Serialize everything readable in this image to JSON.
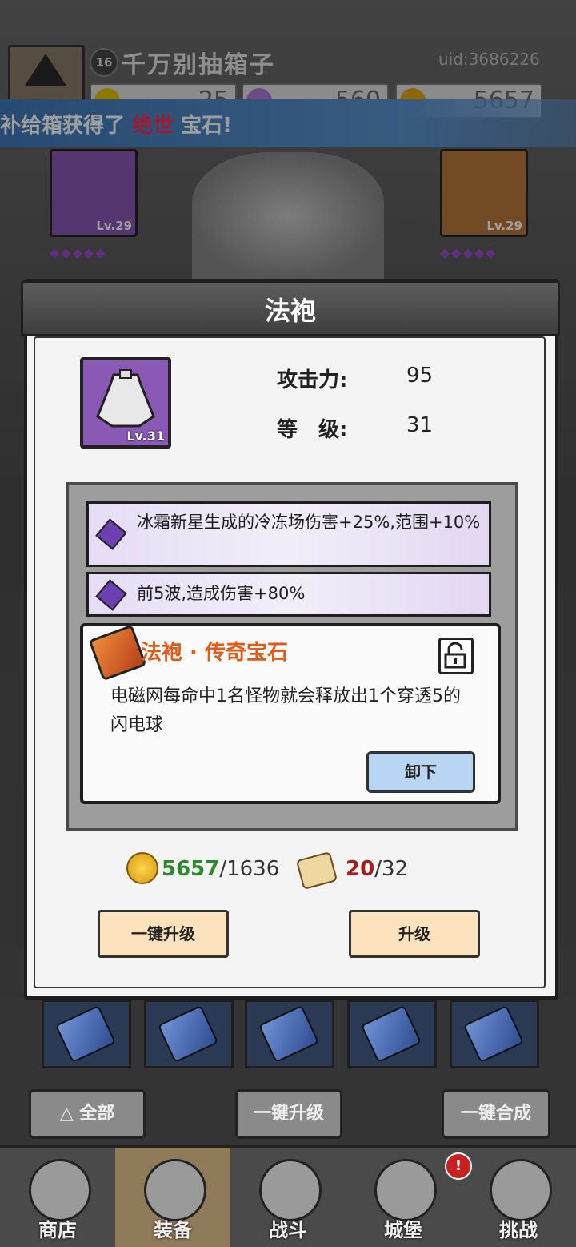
{
  "header": {
    "level": "16",
    "player_name": "千万别抽箱子",
    "uid": "uid:3686226",
    "resources": [
      {
        "name": "energy",
        "value": "25",
        "color": "#e6c400"
      },
      {
        "name": "gem",
        "value": "560",
        "color": "#b07ad8"
      },
      {
        "name": "gold",
        "value": "5657",
        "color": "#e0a818"
      }
    ]
  },
  "banner": {
    "prefix": "补给箱获得了",
    "highlight": "绝世",
    "suffix": "宝石!"
  },
  "equipment": {
    "left_slot_level": "Lv.29",
    "right_slot_level": "Lv.29",
    "left_diamonds": "◆◆◆◆◆",
    "right_diamonds": "◆◆◆◆◆"
  },
  "modal": {
    "title": "法袍",
    "item_level": "Lv.31",
    "stats": [
      {
        "label": "攻击力:",
        "value": "95"
      },
      {
        "label": "等　级:",
        "value": "31"
      }
    ],
    "gem_lines": [
      "冰霜新星生成的冷冻场伤害+25%,范围+10%",
      "前5波,造成伤害+80%"
    ],
    "legendary": {
      "title": "法袍 · 传奇宝石",
      "description": "电磁网每命中1名怪物就会释放出1个穿透5的闪电球",
      "unequip_label": "卸下"
    },
    "cost": {
      "gold_have": "5657",
      "gold_need": "/1636",
      "scroll_have": "20",
      "scroll_need": "/32"
    },
    "buttons": {
      "upgrade_all": "一键升级",
      "upgrade": "升级"
    }
  },
  "bottom_buttons": {
    "all": "全部",
    "upgrade_all": "一键升级",
    "merge_all": "一键合成"
  },
  "navbar": {
    "items": [
      {
        "label": "商店"
      },
      {
        "label": "装备"
      },
      {
        "label": "战斗"
      },
      {
        "label": "城堡"
      },
      {
        "label": "挑战"
      }
    ],
    "castle_badge": "!"
  }
}
